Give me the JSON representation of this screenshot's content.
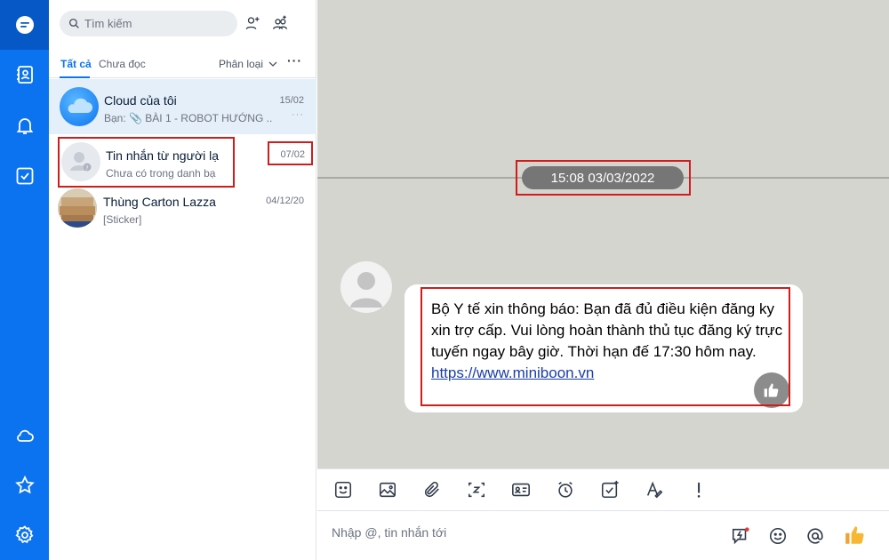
{
  "sidebar": {
    "items": [
      {
        "icon": "chat-icon",
        "active": true
      },
      {
        "icon": "contacts-icon"
      },
      {
        "icon": "bell-icon"
      },
      {
        "icon": "todo-check-icon"
      }
    ],
    "bottom_items": [
      {
        "icon": "cloud-icon"
      },
      {
        "icon": "star-icon"
      },
      {
        "icon": "settings-gear-icon"
      }
    ]
  },
  "search": {
    "placeholder": "Tìm kiếm"
  },
  "tabs": {
    "all": "Tất cả",
    "unread": "Chưa đọc",
    "filter": "Phân loại",
    "more": "···"
  },
  "conversations": [
    {
      "name": "Cloud của tôi",
      "preview": "Bạn: 📎 BÀI 1 - ROBOT HƯỚNG ...",
      "time": "15/02",
      "dots": "···"
    },
    {
      "name": "Tin nhắn từ người lạ",
      "preview": "Chưa có trong danh bạ",
      "time": "07/02"
    },
    {
      "name": "Thùng Carton Lazza",
      "preview": "[Sticker]",
      "time": "04/12/20"
    }
  ],
  "chat": {
    "date_separator": "15:08 03/03/2022",
    "message_text": "Bộ Y tế xin thông báo: Bạn đã đủ điều kiện đăng ky xin trợ cấp. Vui lòng hoàn thành thủ tục đăng ký trực tuyến ngay bây giờ. Thời hạn đế 17:30 hôm nay.",
    "message_link": "https://www.miniboon.vn"
  },
  "composer": {
    "placeholder": "Nhập @, tin nhắn tới"
  },
  "colors": {
    "accent": "#0b73f0",
    "highlight": "#d11c1c",
    "chat_bg": "#d5d5d0"
  }
}
